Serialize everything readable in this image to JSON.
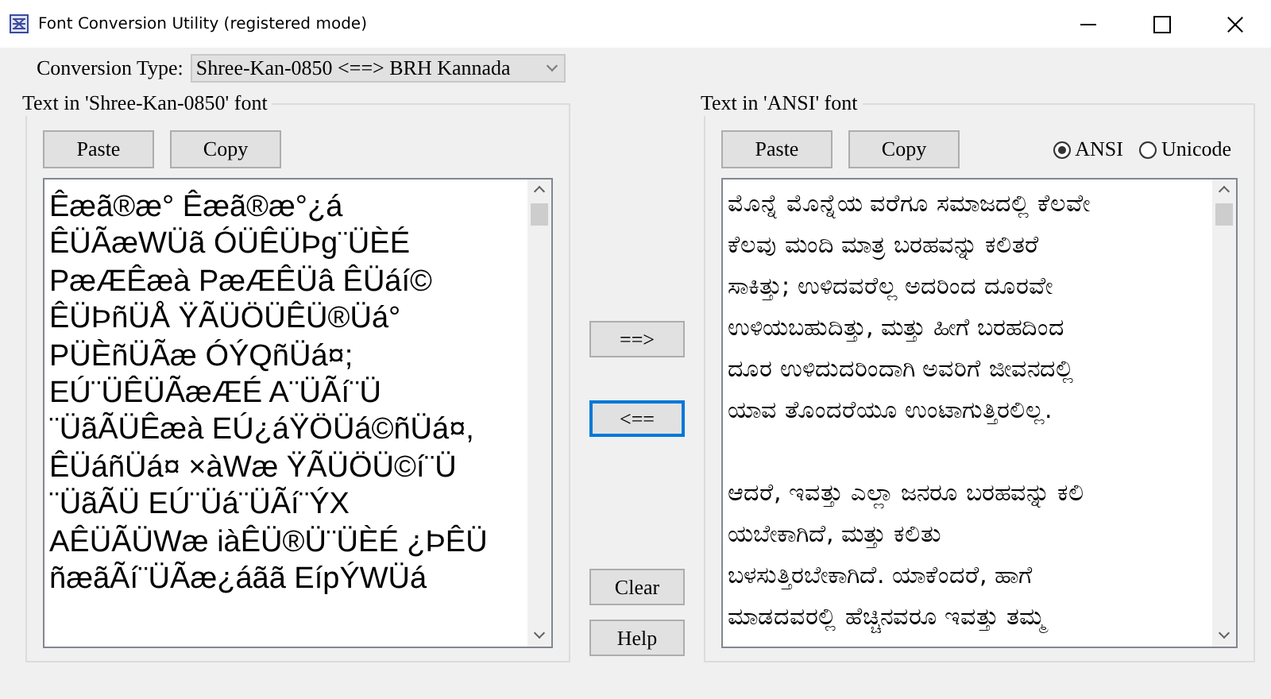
{
  "window": {
    "title": "Font Conversion Utility (registered mode)"
  },
  "conversion": {
    "label": "Conversion Type:",
    "value": "Shree-Kan-0850 <==> BRH Kannada"
  },
  "left_panel": {
    "title": "Text in 'Shree-Kan-0850' font",
    "buttons": [
      "Paste",
      "Copy"
    ],
    "text": "Êæã®æ° Êæã®æ°¿á\nÊÜÃæWÜã ÓÜÊÜÞg¨ÜÈÉ\nPæÆÊæà PæÆÊÜâ ÊÜáí©\nÊÜÞñÜÅ ŸÃÜÖÜÊÜ®Üá°\nPÜÈñÜÃæ ÓÝQñÜá¤;\nEÚ¨ÜÊÜÃæÆÉ A¨ÜÃí¨Ü\n¨ÜãÃÜÊæà EÚ¿áŸÖÜá©ñÜá¤,\nÊÜáñÜá¤ ×àWæ ŸÃÜÖÜ©í¨Ü\n¨ÜãÃÜ EÚ¨Üá¨ÜÃí¨ÝX\nAÊÜÃÜWæ iàÊÜ®Ü¨ÜÈÉ ¿ÞÊÜ\nñæãÃí¨ÜÃæ¿áãã EípÝWÜá"
  },
  "middle_buttons": [
    {
      "label": "==>",
      "focused": false
    },
    {
      "label": "<==",
      "focused": true
    },
    {
      "label": "Clear",
      "focused": false
    },
    {
      "label": "Help",
      "focused": false
    }
  ],
  "right_panel": {
    "title": "Text in 'ANSI' font",
    "buttons": [
      "Paste",
      "Copy"
    ],
    "radios": [
      {
        "label": "ANSI",
        "selected": true
      },
      {
        "label": "Unicode",
        "selected": false
      }
    ],
    "text": "ಮೊನ್ನೆ ಮೊನ್ನೆಯ ವರೆಗೂ ಸಮಾಜದಲ್ಲಿ ಕೆಲವೇ\nಕೆಲವು ಮಂದಿ ಮಾತ್ರ ಬರಹವನ್ನು ಕಲಿತರೆ\nಸಾಕಿತ್ತು; ಉಳಿದವರೆಲ್ಲ ಅದರಿಂದ ದೂರವೇ\nಉಳಿಯಬಹುದಿತ್ತು, ಮತ್ತು ಹೀಗೆ ಬರಹದಿಂದ\nದೂರ ಉಳಿದುದರಿಂದಾಗಿ ಅವರಿಗೆ ಜೀವನದಲ್ಲಿ\nಯಾವ ತೊಂದರೆಯೂ ಉಂಟಾಗುತ್ತಿರಲಿಲ್ಲ.\n\nಆದರೆ, ಇವತ್ತು ಎಲ್ಲಾ ಜನರೂ ಬರಹವನ್ನು ಕಲಿ\nಯಬೇಕಾಗಿದೆ, ಮತ್ತು ಕಲಿತು\nಬಳಸುತ್ತಿರಬೇಕಾಗಿದೆ. ಯಾಕೆಂದರೆ, ಹಾಗೆ\nಮಾಡದವರಲ್ಲಿ ಹೆಚ್ಚಿನವರೂ ಇವತ್ತು ತಮ್ಮ"
  }
}
